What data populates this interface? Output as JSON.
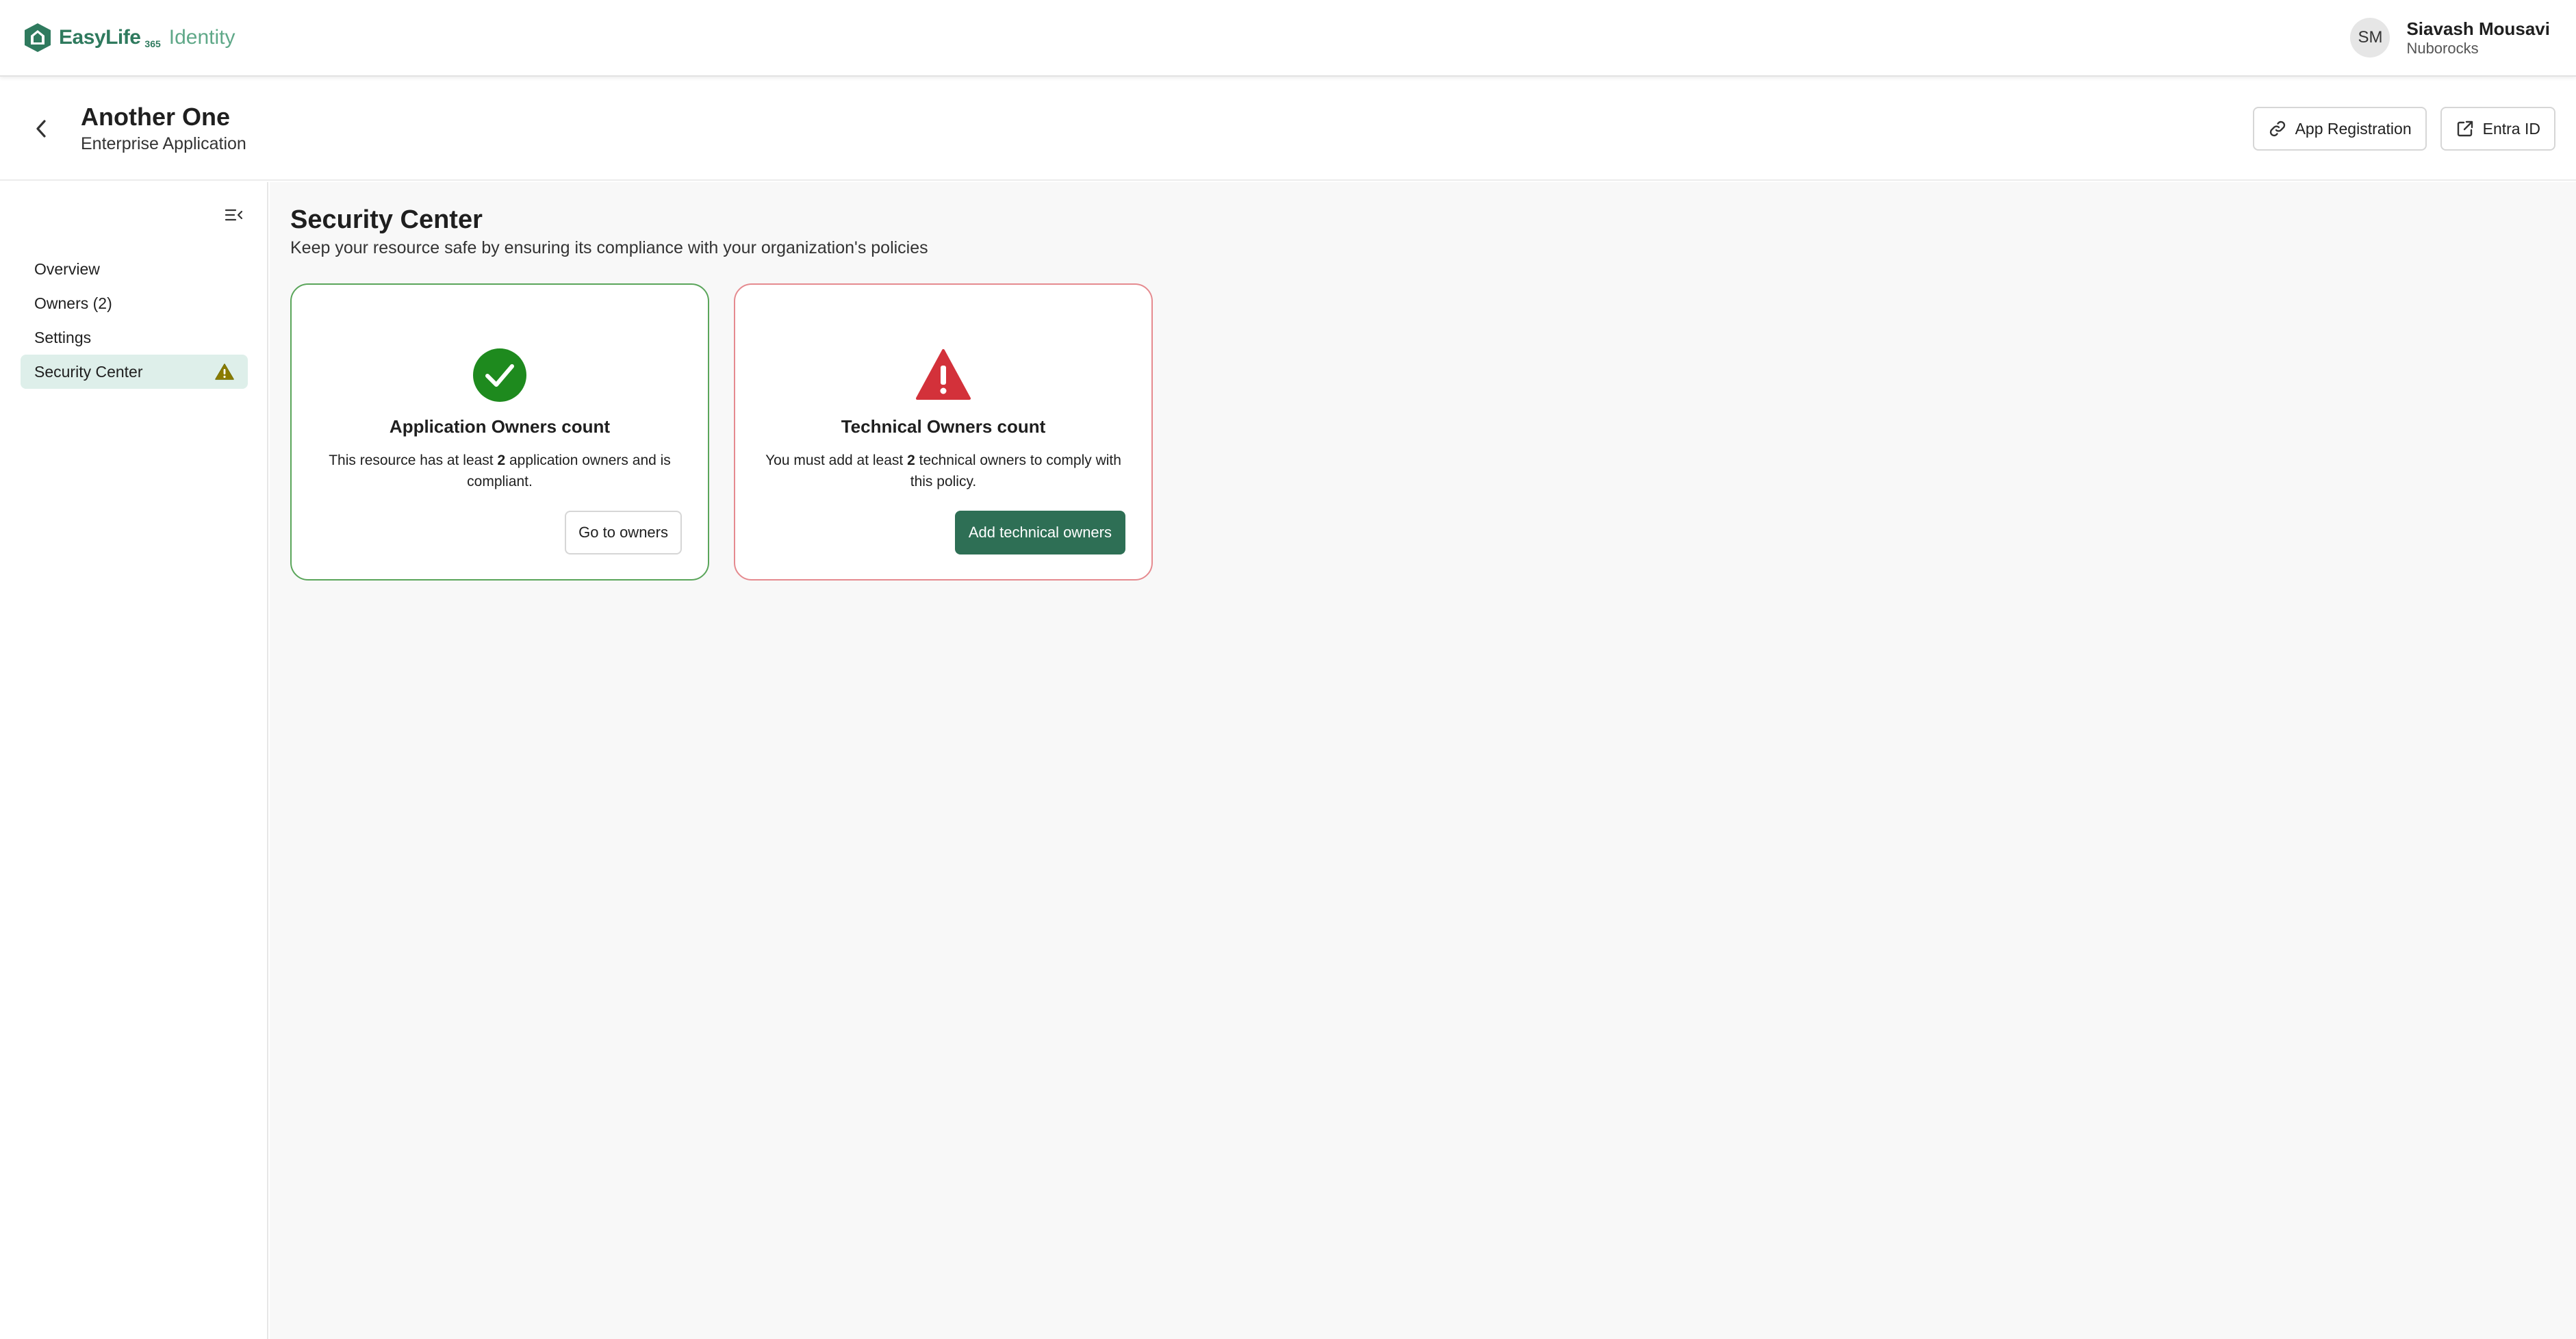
{
  "brand": {
    "name": "EasyLife",
    "superscript": "365",
    "product": "Identity",
    "color": "#2f7a5e",
    "logo_icon": "house-shield-icon"
  },
  "user": {
    "initials": "SM",
    "name": "Siavash Mousavi",
    "organization": "Nuborocks"
  },
  "resource": {
    "title": "Another One",
    "subtitle": "Enterprise Application",
    "back_icon": "chevron-left-icon",
    "actions": [
      {
        "label": "App Registration",
        "icon": "link-icon"
      },
      {
        "label": "Entra ID",
        "icon": "external-link-icon"
      }
    ]
  },
  "sidebar": {
    "collapse_icon": "collapse-sidebar-icon",
    "items": [
      {
        "label": "Overview",
        "active": false
      },
      {
        "label": "Owners (2)",
        "active": false
      },
      {
        "label": "Settings",
        "active": false
      },
      {
        "label": "Security Center",
        "active": true,
        "badge_icon": "warning-triangle-icon"
      }
    ],
    "active_color": "#deefea"
  },
  "main": {
    "title": "Security Center",
    "description": "Keep your resource safe by ensuring its compliance with your organization's policies",
    "cards": [
      {
        "status": "compliant",
        "icon": "check-circle-icon",
        "color": "#1e8a1e",
        "title": "Application Owners count",
        "text_before": "This resource has at least ",
        "text_bold": "2",
        "text_after": " application owners and is compliant.",
        "button_label": "Go to owners"
      },
      {
        "status": "non-compliant",
        "icon": "warning-triangle-icon",
        "color": "#d3313a",
        "title": "Technical Owners count",
        "text_before": "You must add at least ",
        "text_bold": "2",
        "text_after": " technical owners to comply with this policy.",
        "button_label": "Add technical owners"
      }
    ]
  }
}
